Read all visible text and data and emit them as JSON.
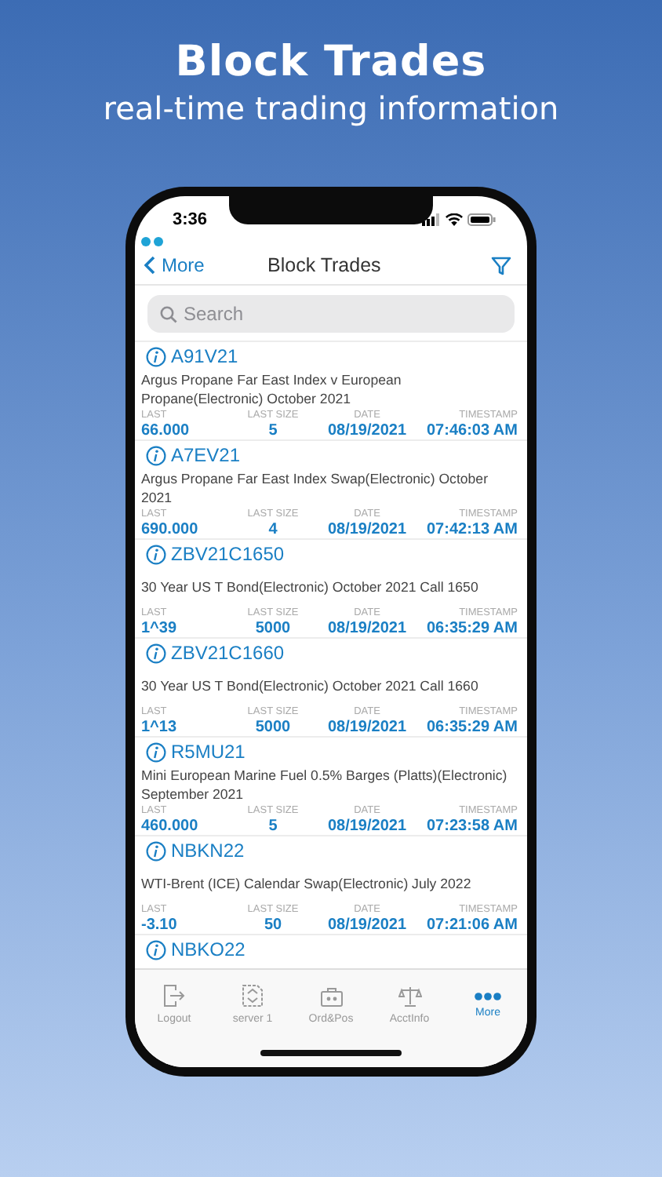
{
  "banner": {
    "title": "Block Trades",
    "subtitle": "real-time trading information"
  },
  "status_bar": {
    "time": "3:36"
  },
  "nav": {
    "back": "More",
    "title": "Block Trades"
  },
  "search": {
    "placeholder": "Search"
  },
  "trades": [
    {
      "symbol": "A91V21",
      "description": "Argus Propane Far East Index v European Propane(Electronic) October 2021",
      "labels": [
        "LAST",
        "LAST SIZE",
        "DATE",
        "TIMESTAMP"
      ],
      "last": "66.000",
      "last_size": "5",
      "date": "08/19/2021",
      "timestamp": "07:46:03 AM"
    },
    {
      "symbol": "A7EV21",
      "description": "Argus Propane Far East Index Swap(Electronic) October 2021",
      "labels": [
        "LAST",
        "LAST SIZE",
        "DATE",
        "TIMESTAMP"
      ],
      "last": "690.000",
      "last_size": "4",
      "date": "08/19/2021",
      "timestamp": "07:42:13 AM"
    },
    {
      "symbol": "ZBV21C1650",
      "description": "30 Year US T Bond(Electronic) October 2021 Call 1650",
      "labels": [
        "LAST",
        "LAST SIZE",
        "DATE",
        "TIMESTAMP"
      ],
      "last": "1^39",
      "last_size": "5000",
      "date": "08/19/2021",
      "timestamp": "06:35:29 AM"
    },
    {
      "symbol": "ZBV21C1660",
      "description": "30 Year US T Bond(Electronic) October 2021 Call 1660",
      "labels": [
        "LAST",
        "LAST SIZE",
        "DATE",
        "TIMESTAMP"
      ],
      "last": "1^13",
      "last_size": "5000",
      "date": "08/19/2021",
      "timestamp": "06:35:29 AM"
    },
    {
      "symbol": "R5MU21",
      "description": "Mini European Marine Fuel 0.5% Barges (Platts)(Electronic) September 2021",
      "labels": [
        "LAST",
        "LAST SIZE",
        "DATE",
        "TIMESTAMP"
      ],
      "last": "460.000",
      "last_size": "5",
      "date": "08/19/2021",
      "timestamp": "07:23:58 AM"
    },
    {
      "symbol": "NBKN22",
      "description": "WTI-Brent (ICE) Calendar Swap(Electronic) July 2022",
      "labels": [
        "LAST",
        "LAST SIZE",
        "DATE",
        "TIMESTAMP"
      ],
      "last": "-3.10",
      "last_size": "50",
      "date": "08/19/2021",
      "timestamp": "07:21:06 AM"
    },
    {
      "symbol": "NBKO22"
    }
  ],
  "tab_bar": [
    {
      "kind": "logout",
      "label": "Logout",
      "selected": false
    },
    {
      "kind": "server",
      "label": "server 1",
      "selected": false
    },
    {
      "kind": "orders",
      "label": "Ord&Pos",
      "selected": false
    },
    {
      "kind": "account",
      "label": "AcctInfo",
      "selected": false
    },
    {
      "kind": "more",
      "label": "More",
      "selected": true
    }
  ]
}
